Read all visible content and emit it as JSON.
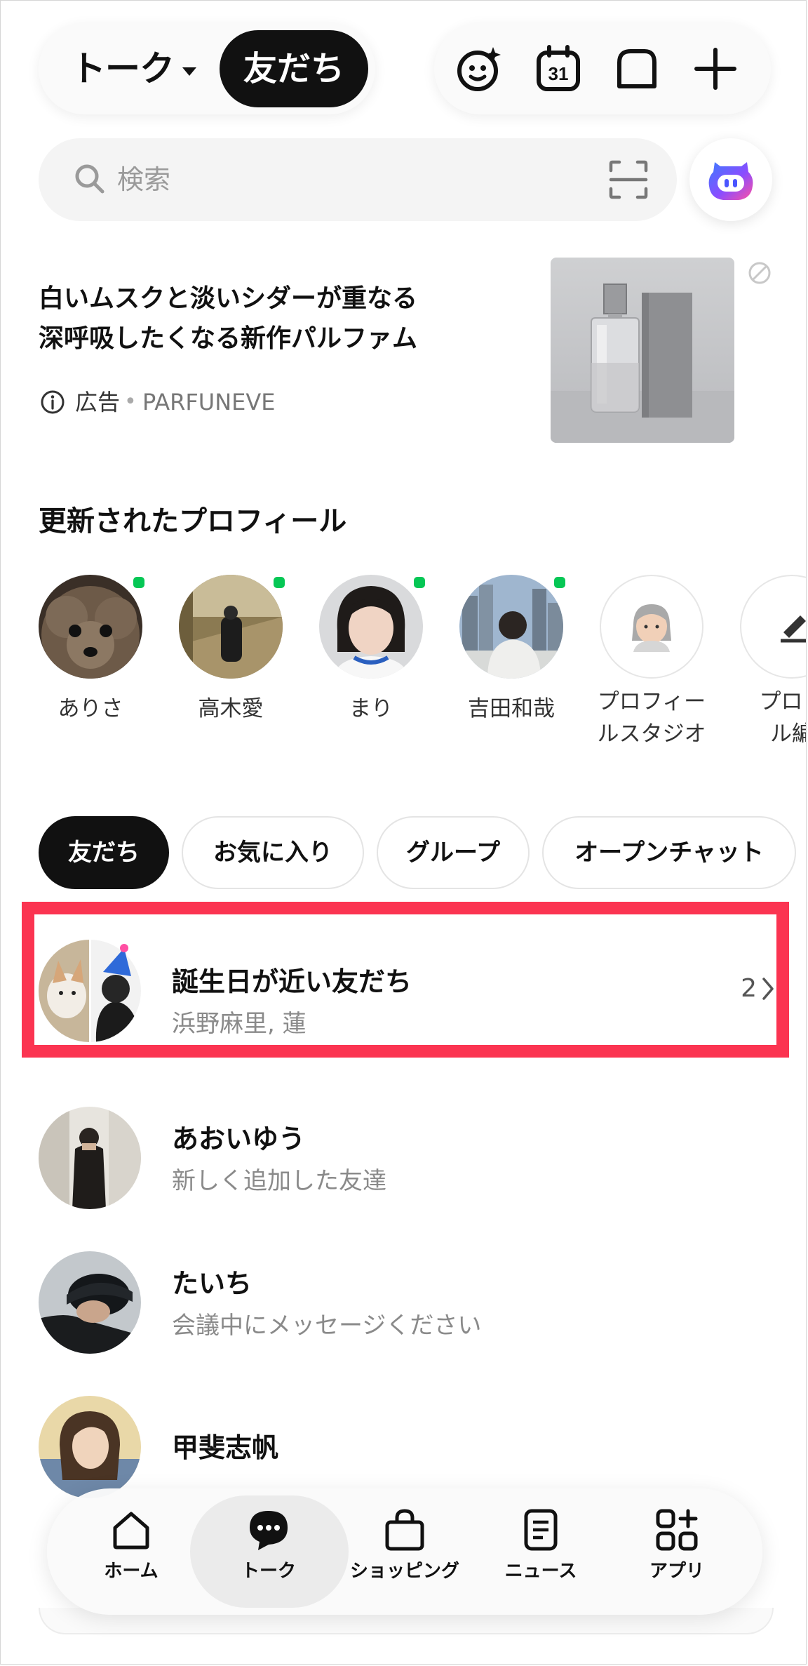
{
  "header": {
    "talk_label": "トーク",
    "friends_label": "友だち",
    "icons": [
      "sparkle-face-icon",
      "calendar-icon",
      "chat-bubble-icon",
      "plus-icon"
    ],
    "calendar_day": "31"
  },
  "search": {
    "placeholder": "検索",
    "icons": [
      "search-icon",
      "scan-icon",
      "ai-assistant-icon"
    ]
  },
  "ad": {
    "headline_line1": "白いムスクと淡いシダーが重なる",
    "headline_line2": "深呼吸したくなる新作パルファム",
    "label": "広告",
    "separator": "•",
    "brand": "PARFUNEVE"
  },
  "updated_profiles": {
    "title": "更新されたプロフィール",
    "items": [
      {
        "name": "ありさ",
        "online": true
      },
      {
        "name": "高木愛",
        "online": true
      },
      {
        "name": "まり",
        "online": true
      },
      {
        "name": "吉田和哉",
        "online": true
      },
      {
        "name_line1": "プロフィー",
        "name_line2": "ルスタジオ",
        "icon": "avatar-emoji-icon"
      },
      {
        "name_line1": "プロフ",
        "name_line2": "ル編",
        "icon": "edit-icon"
      }
    ]
  },
  "tabs": [
    {
      "label": "友だち",
      "active": true
    },
    {
      "label": "お気に入り",
      "active": false
    },
    {
      "label": "グループ",
      "active": false
    },
    {
      "label": "オープンチャット",
      "active": false
    }
  ],
  "birthday": {
    "title": "誕生日が近い友だち",
    "subtitle": "浜野麻里, 蓮",
    "count": "2"
  },
  "friends": [
    {
      "name": "あおいゆう",
      "status": "新しく追加した友達"
    },
    {
      "name": "たいち",
      "status": "会議中にメッセージください"
    },
    {
      "name": "甲斐志帆",
      "status": ""
    }
  ],
  "nav": [
    {
      "label": "ホーム",
      "icon": "home-icon",
      "active": false
    },
    {
      "label": "トーク",
      "icon": "talk-icon",
      "active": true
    },
    {
      "label": "ショッピング",
      "icon": "shopping-bag-icon",
      "active": false
    },
    {
      "label": "ニュース",
      "icon": "news-icon",
      "active": false
    },
    {
      "label": "アプリ",
      "icon": "apps-icon",
      "active": false
    }
  ],
  "colors": {
    "highlight_border": "#fb3451",
    "online_dot": "#06c755",
    "active_tab": "#111111"
  }
}
